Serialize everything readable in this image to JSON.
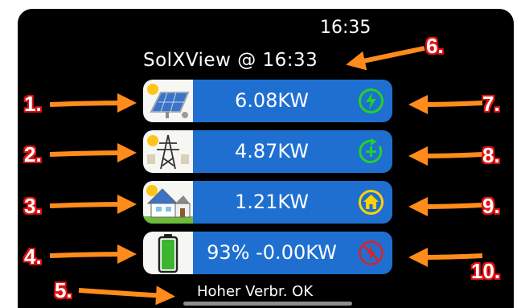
{
  "status_bar": {
    "time": "16:35"
  },
  "header": {
    "title": "SolXView @ 16:33"
  },
  "rows": [
    {
      "icon": "solar-panel-icon",
      "value": "6.08KW",
      "status_icon": "lightning-bolt-icon",
      "status_color": "#22d12a"
    },
    {
      "icon": "power-grid-tower-icon",
      "value": "4.87KW",
      "status_icon": "plus-cycle-icon",
      "status_color": "#22d12a"
    },
    {
      "icon": "house-solar-roof-icon",
      "value": "1.21KW",
      "status_icon": "home-icon",
      "status_color": "#ffd200"
    },
    {
      "icon": "battery-icon",
      "value": "93% -0.00KW",
      "status_icon": "no-charge-icon",
      "status_color": "#e02020",
      "battery_level": 0.93
    }
  ],
  "footer": {
    "text": "Hoher Verbr. OK"
  },
  "callouts": [
    "1.",
    "2.",
    "3.",
    "4.",
    "5.",
    "6.",
    "7.",
    "8.",
    "9.",
    "10."
  ],
  "colors": {
    "row_background": "#1f6fd1",
    "arrow": "#ff8c1a",
    "callout_outline": "#e01010"
  }
}
